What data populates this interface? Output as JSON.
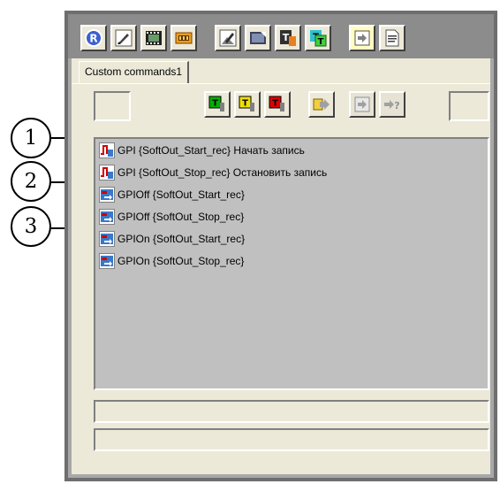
{
  "toolbar": {
    "buttons": [
      {
        "icon": "registered-icon"
      },
      {
        "icon": "edit-pencil-icon"
      },
      {
        "icon": "film-strip-icon"
      },
      {
        "icon": "tape-icon"
      },
      {
        "icon": "edit-image-icon"
      },
      {
        "icon": "filter-icon"
      },
      {
        "icon": "text-tool-icon"
      },
      {
        "icon": "title-tool-icon"
      },
      {
        "icon": "export-icon",
        "highlighted": true
      },
      {
        "icon": "document-icon"
      }
    ]
  },
  "tab": {
    "label": "Custom commands1"
  },
  "panel": {
    "buttons": [
      {
        "icon": "green-t-icon",
        "color": "#00b000"
      },
      {
        "icon": "yellow-t-icon",
        "color": "#f0e000"
      },
      {
        "icon": "red-t-icon",
        "color": "#e00000"
      },
      {
        "icon": "forward-icon"
      },
      {
        "icon": "export-disabled-icon"
      },
      {
        "icon": "help-arrow-icon",
        "text": "?"
      }
    ]
  },
  "commands": [
    {
      "type": "gpi",
      "label": "GPI {SoftOut_Start_rec} Начать запись"
    },
    {
      "type": "gpi",
      "label": "GPI {SoftOut_Stop_rec} Остановить запись"
    },
    {
      "type": "gpio",
      "label": "GPIOff {SoftOut_Start_rec}"
    },
    {
      "type": "gpio",
      "label": "GPIOff {SoftOut_Stop_rec}"
    },
    {
      "type": "gpio",
      "label": "GPIOn {SoftOut_Start_rec}"
    },
    {
      "type": "gpio",
      "label": "GPIOn {SoftOut_Stop_rec}"
    }
  ],
  "callouts": [
    "1",
    "2",
    "3"
  ],
  "colors": {
    "accent_yellow": "#fffdc0",
    "list_bg": "#c0c0c0",
    "panel_bg": "#ece9d8",
    "gpi_red": "#d00000",
    "gpio_blue": "#3a78c8"
  }
}
